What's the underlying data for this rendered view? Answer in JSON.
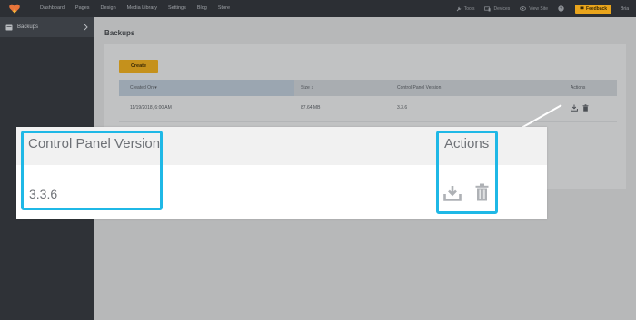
{
  "topbar": {
    "logo_icon": "heart-logo-icon",
    "nav": [
      "Dashboard",
      "Pages",
      "Design",
      "Media Library",
      "Settings",
      "Blog",
      "Store"
    ],
    "tools_label": "Tools",
    "devices_label": "Devices",
    "view_site_label": "View Site",
    "help_icon": "help-icon",
    "feedback_label": "Feedback",
    "user_label": "Bria"
  },
  "sidebar": {
    "items": [
      {
        "label": "Backups",
        "icon": "backups-icon"
      }
    ]
  },
  "main": {
    "page_title": "Backups",
    "create_label": "Create",
    "table": {
      "columns": [
        "Created On ▾",
        "Size ↕",
        "Control Panel Version",
        "Actions"
      ],
      "rows": [
        {
          "created_on": "11/19/2018, 6:00 AM",
          "size": "87.64 MB",
          "version": "3.3.6"
        }
      ]
    }
  },
  "callout": {
    "version_header": "Control Panel Version",
    "actions_header": "Actions",
    "version_value": "3.3.6",
    "highlight_color": "#1fb8e6"
  },
  "colors": {
    "accent": "#e8a41c",
    "topbar": "#2c2f34",
    "sidebar": "#2f3237"
  }
}
